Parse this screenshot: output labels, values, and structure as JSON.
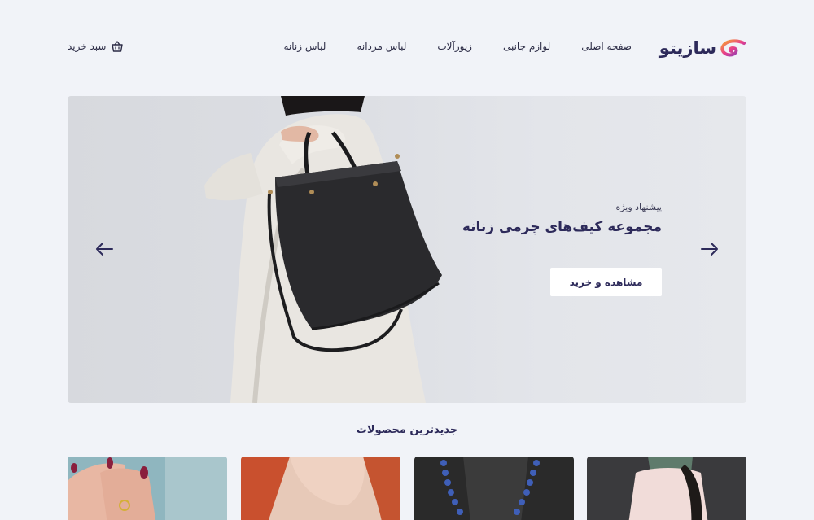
{
  "brand": {
    "name": "سازیتو"
  },
  "nav": {
    "items": [
      {
        "label": "صفحه اصلی"
      },
      {
        "label": "لوازم جانبی"
      },
      {
        "label": "زیورآلات"
      },
      {
        "label": "لباس مردانه"
      },
      {
        "label": "لباس زنانه"
      }
    ]
  },
  "cart": {
    "label": "سبد خرید",
    "icon": "basket-icon"
  },
  "hero": {
    "eyebrow": "پیشنهاد ویژه",
    "title": "مجموعه کیف‌های چرمی زنانه",
    "button": "مشاهده و خرید",
    "prev_icon": "arrow-left-icon",
    "next_icon": "arrow-right-icon"
  },
  "section": {
    "title": "جدیدترین محصولات"
  },
  "colors": {
    "background": "#f1f3f8",
    "brand_dark": "#2d2a5a",
    "logo_pink": "#e83e8c",
    "logo_orange": "#f7a531",
    "logo_purple": "#6f42c1"
  }
}
